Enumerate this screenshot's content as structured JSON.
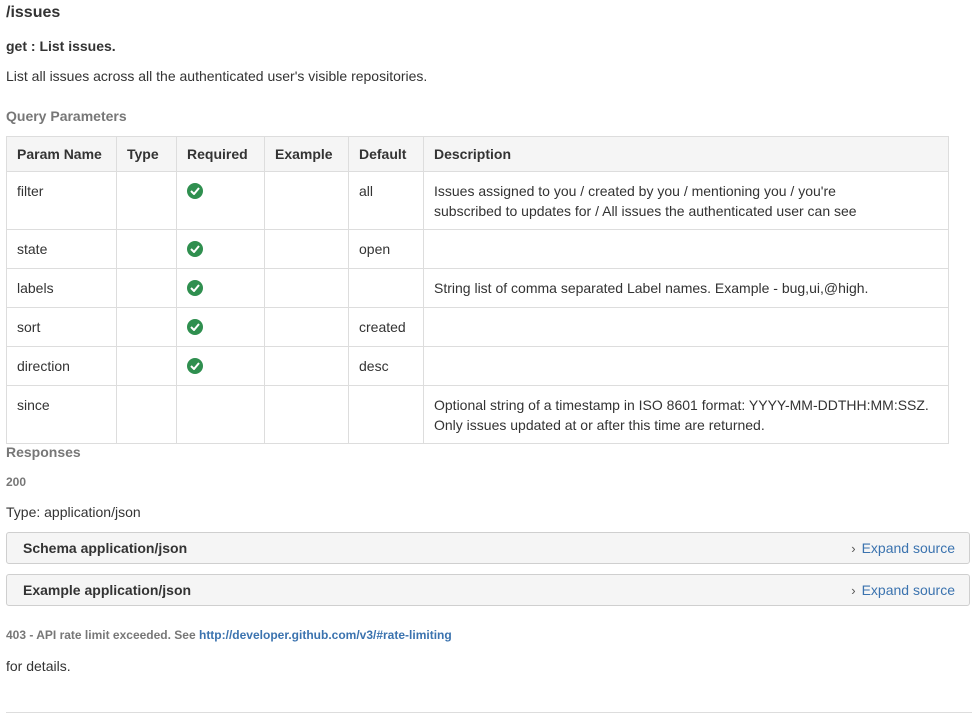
{
  "resource": {
    "path": "/issues"
  },
  "method": {
    "label": "get : List issues."
  },
  "description": "List all issues across all the authenticated user's visible repositories.",
  "query_params": {
    "title": "Query Parameters",
    "headers": [
      "Param Name",
      "Type",
      "Required",
      "Example",
      "Default",
      "Description"
    ],
    "rows": [
      {
        "name": "filter",
        "type": "",
        "required": true,
        "example": "",
        "default": "all",
        "description_lines": [
          "Issues assigned to you / created by you / mentioning you / you're",
          "subscribed to updates for / All issues the authenticated user can see"
        ]
      },
      {
        "name": "state",
        "type": "",
        "required": true,
        "example": "",
        "default": "open",
        "description_lines": [
          ""
        ]
      },
      {
        "name": "labels",
        "type": "",
        "required": true,
        "example": "",
        "default": "",
        "description_lines": [
          "String list of comma separated Label names. Example - bug,ui,@high."
        ]
      },
      {
        "name": "sort",
        "type": "",
        "required": true,
        "example": "",
        "default": "created",
        "description_lines": [
          ""
        ]
      },
      {
        "name": "direction",
        "type": "",
        "required": true,
        "example": "",
        "default": "desc",
        "description_lines": [
          ""
        ]
      },
      {
        "name": "since",
        "type": "",
        "required": false,
        "example": "",
        "default": "",
        "description_lines": [
          "Optional string of a timestamp in ISO 8601 format: YYYY-MM-DDTHH:MM:SSZ.",
          "Only issues updated at or after this time are returned."
        ]
      }
    ]
  },
  "responses": {
    "title": "Responses",
    "code_200": "200",
    "type_label": "Type: application/json",
    "panels": [
      {
        "title": "Schema application/json",
        "expand": "Expand source",
        "chevron_icon": "chevron-right-icon"
      },
      {
        "title": "Example application/json",
        "expand": "Expand source",
        "chevron_icon": "chevron-right-icon"
      }
    ],
    "error": {
      "prefix": "403 - API rate limit exceeded. See ",
      "link_text": "http://developer.github.com/v3/#rate-limiting",
      "suffix": "for details."
    }
  },
  "colors": {
    "check_green": "#2f8f4f",
    "link": "#3b73af",
    "muted": "#777777"
  }
}
